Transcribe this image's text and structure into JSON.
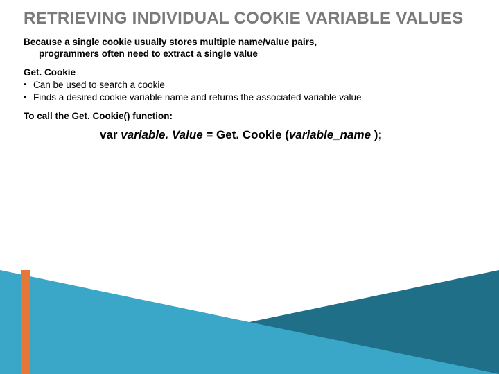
{
  "title": "RETRIEVING INDIVIDUAL COOKIE VARIABLE VALUES",
  "lead_line1": "Because a single cookie usually stores multiple name/value pairs,",
  "lead_line2": "programmers often need to extract a single value",
  "subhead": "Get. Cookie",
  "bullets": [
    "Can be used to search a cookie",
    "Finds a desired cookie variable name and returns the associated variable value"
  ],
  "call": "To call the Get. Cookie() function:",
  "code": {
    "pre": "var ",
    "ital1": "variable. Value",
    "mid": " = Get. Cookie (",
    "ital2": "variable_name ",
    "post": ");"
  },
  "colors": {
    "title_gray": "#7a7a7a",
    "triangle_dark": "#1f6f89",
    "triangle_light": "#3aa7c9",
    "accent_bar": "#e57838"
  }
}
